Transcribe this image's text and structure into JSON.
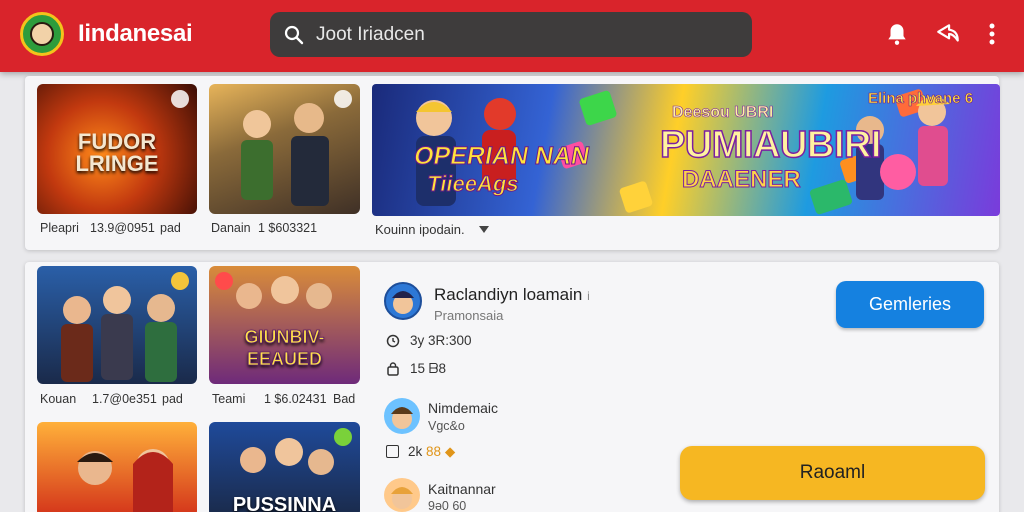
{
  "header": {
    "brand": "Iindanesai",
    "search_text": "Joot Iriadcen",
    "icons": [
      "bell-icon",
      "share-icon",
      "more-vert-icon"
    ]
  },
  "top_row": {
    "thumbs": [
      {
        "title": "FUDOR\nLRINGE"
      },
      {
        "title": ""
      }
    ],
    "captions": [
      "Pleapri",
      "13.9@0951",
      "pad",
      "Danain",
      "1 $603321"
    ],
    "banner": {
      "corner_text": "Elina phvane 6",
      "left_title": "OPERIAN NAN",
      "left_sub": "TiieeAgs",
      "center_title": "PUMIAUBIRI",
      "center_sub": "DAAENER",
      "top_small": "Deesou UBRI"
    },
    "dropdown_label": "Kouinn ipodain."
  },
  "bottom_grid": {
    "thumbs": [
      {
        "title": ""
      },
      {
        "title": "GIUNBIV-\nEEAUED"
      },
      {
        "title": ""
      },
      {
        "title": "PUSSINNA"
      }
    ],
    "captions": [
      "Kouan",
      "1.7@0e351",
      "pad",
      "Teami",
      "1 $6.02431",
      "Bad"
    ]
  },
  "detail": {
    "title": "Raclandiyn loamain",
    "title_suffix": "i",
    "subtitle": "Pramonsaia",
    "stat1": "3y 3R:300",
    "stat2": "15 ᗷ8",
    "follow_button": "Gemleries",
    "items": [
      {
        "name": "Nimdemaic",
        "sub": "Vgc&o"
      },
      {
        "name": "Kaitnannar",
        "sub": "9ǝ0 60"
      }
    ],
    "item1_stat": "2k",
    "item1_stat_b": "88",
    "primary_button": "Raoaml"
  }
}
